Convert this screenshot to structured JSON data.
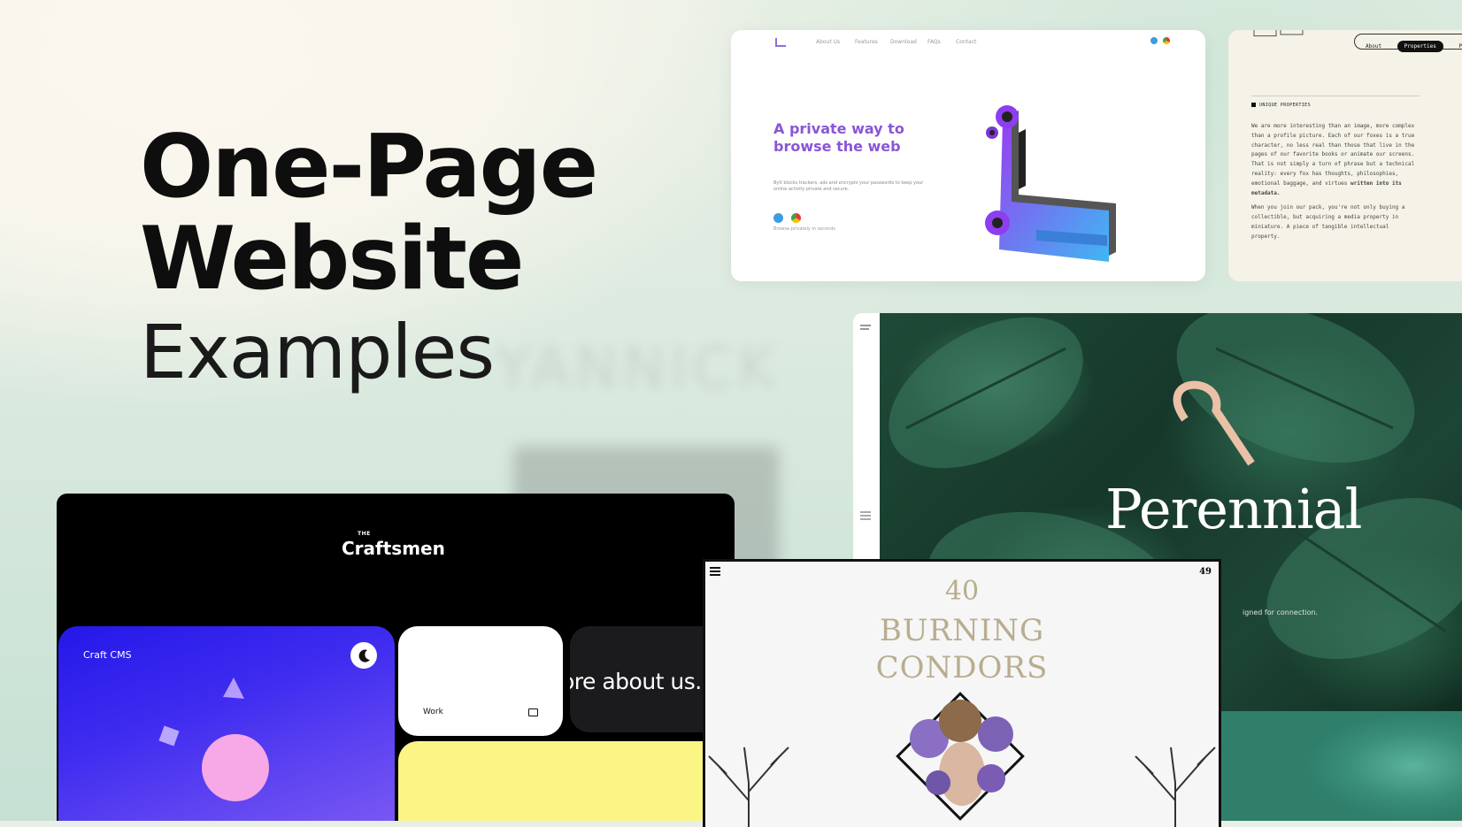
{
  "hero": {
    "line1": "One-Page",
    "line2": "Website",
    "line3": "Examples"
  },
  "private_site": {
    "nav": [
      "About Us",
      "Features",
      "Download",
      "FAQs",
      "Contact"
    ],
    "headline": "A private way to browse the web",
    "subtext": "Bylt blocks trackers, ads and encrypts your passwords to keep your online activity private and secure.",
    "small": "Browse privately in seconds"
  },
  "properties_site": {
    "tabs": [
      "About",
      "Properties",
      "Pe"
    ],
    "heading": "UNIQUE PROPERTIES",
    "para1_normal": "We are more interesting than an image, more complex than a profile picture. Each of our foxes is a true character, no less real than those that live in the pages of our favorite books or animate our screens. That is not simply a turn of phrase but a technical reality: every fox has thoughts, philosophies, emotional baggage, and virtues",
    "para1_bold": "written into its metadata.",
    "para2": "When you join our pack, you're not only buying a collectible, but acquiring a media property in miniature. A piece of tangible intellectual property."
  },
  "perennial_site": {
    "wordmark": "Perennial",
    "tag": "igned for connection."
  },
  "craftsmen_site": {
    "logo_small": "THE",
    "logo": "Craftsmen",
    "tile_blue_label": "Craft CMS",
    "tile_white_label": "Work",
    "marquee": "ore about us. L"
  },
  "condors_site": {
    "number": "40",
    "title_line1": "BURNING",
    "title_line2": "CONDORS",
    "badge": "49"
  },
  "colors": {
    "purple": "#8a56d6",
    "blue_tile": "#2418e8",
    "yellow_tile": "#faf585",
    "leaf_green": "#1f4a38",
    "condor_gold": "#b8ad8f"
  }
}
